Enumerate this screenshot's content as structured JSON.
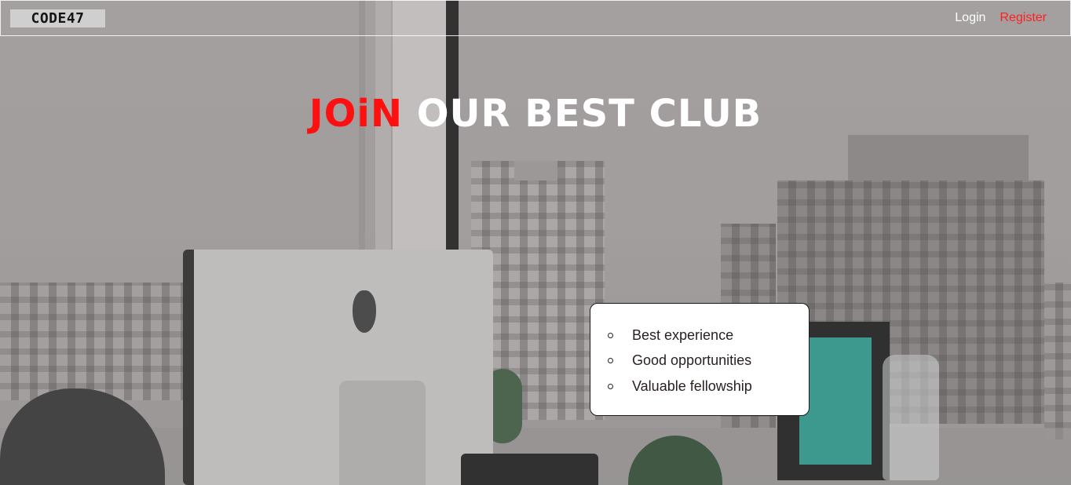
{
  "header": {
    "logo_text": "CODE47",
    "nav": {
      "login_label": "Login",
      "register_label": "Register"
    }
  },
  "hero": {
    "title_accent": "JOiN",
    "title_rest": "OUR BEST CLUB"
  },
  "benefits": {
    "items": [
      "Best experience",
      "Good opportunities",
      "Valuable fellowship"
    ]
  },
  "colors": {
    "accent": "#ff1010",
    "nav_text": "#ffffff",
    "card_background": "#ffffff"
  }
}
